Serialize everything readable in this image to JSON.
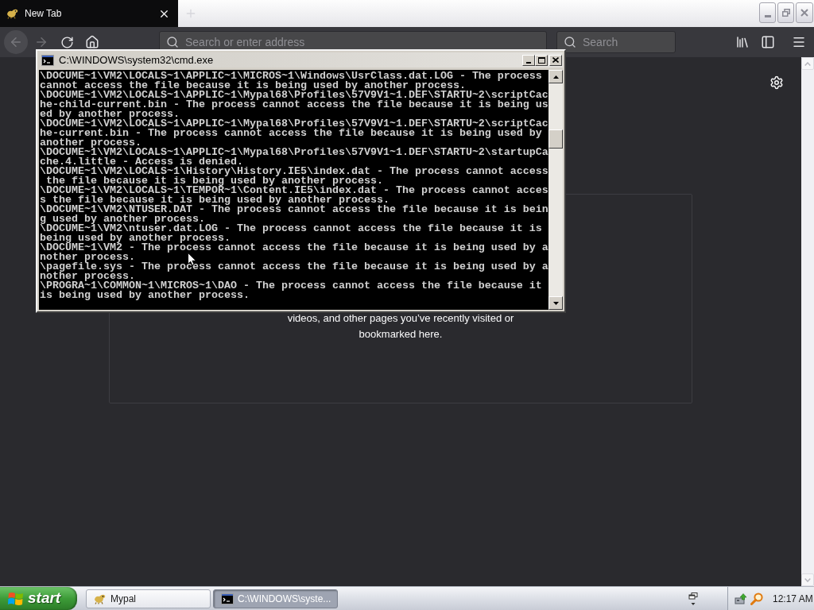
{
  "browser": {
    "tabs": [
      {
        "title": "New Tab",
        "selected": true
      }
    ],
    "address_bar": {
      "placeholder": "Search or enter address"
    },
    "search_bar": {
      "placeholder": "Search"
    },
    "content": {
      "message": "videos, and other pages you’ve recently visited or bookmarked here."
    }
  },
  "console_window": {
    "title": "C:\\WINDOWS\\system32\\cmd.exe",
    "lines": [
      "\\DOCUME~1\\VM2\\LOCALS~1\\APPLIC~1\\MICROS~1\\Windows\\UsrClass.dat.LOG - The process",
      "cannot access the file because it is being used by another process.",
      "\\DOCUME~1\\VM2\\LOCALS~1\\APPLIC~1\\Mypal68\\Profiles\\57V9V1~1.DEF\\STARTU~2\\scriptCac",
      "he-child-current.bin - The process cannot access the file because it is being us",
      "ed by another process.",
      "\\DOCUME~1\\VM2\\LOCALS~1\\APPLIC~1\\Mypal68\\Profiles\\57V9V1~1.DEF\\STARTU~2\\scriptCac",
      "he-current.bin - The process cannot access the file because it is being used by",
      "another process.",
      "\\DOCUME~1\\VM2\\LOCALS~1\\APPLIC~1\\Mypal68\\Profiles\\57V9V1~1.DEF\\STARTU~2\\startupCa",
      "che.4.little - Access is denied.",
      "\\DOCUME~1\\VM2\\LOCALS~1\\History\\History.IE5\\index.dat - The process cannot access",
      " the file because it is being used by another process.",
      "\\DOCUME~1\\VM2\\LOCALS~1\\TEMPOR~1\\Content.IE5\\index.dat - The process cannot acces",
      "s the file because it is being used by another process.",
      "\\DOCUME~1\\VM2\\NTUSER.DAT - The process cannot access the file because it is bein",
      "g used by another process.",
      "\\DOCUME~1\\VM2\\ntuser.dat.LOG - The process cannot access the file because it is",
      "being used by another process.",
      "\\DOCUME~1\\VM2 - The process cannot access the file because it is being used by a",
      "nother process.",
      "\\pagefile.sys - The process cannot access the file because it is being used by a",
      "nother process.",
      "\\PROGRA~1\\COMMON~1\\MICROS~1\\DAO - The process cannot access the file because it",
      "is being used by another process."
    ]
  },
  "taskbar": {
    "start_label": "start",
    "buttons": [
      {
        "kind": "browser",
        "label": "Mypal",
        "selected": false
      },
      {
        "kind": "console",
        "label": "C:\\WINDOWS\\syste...",
        "selected": true
      }
    ],
    "clock": "12:17 AM"
  }
}
